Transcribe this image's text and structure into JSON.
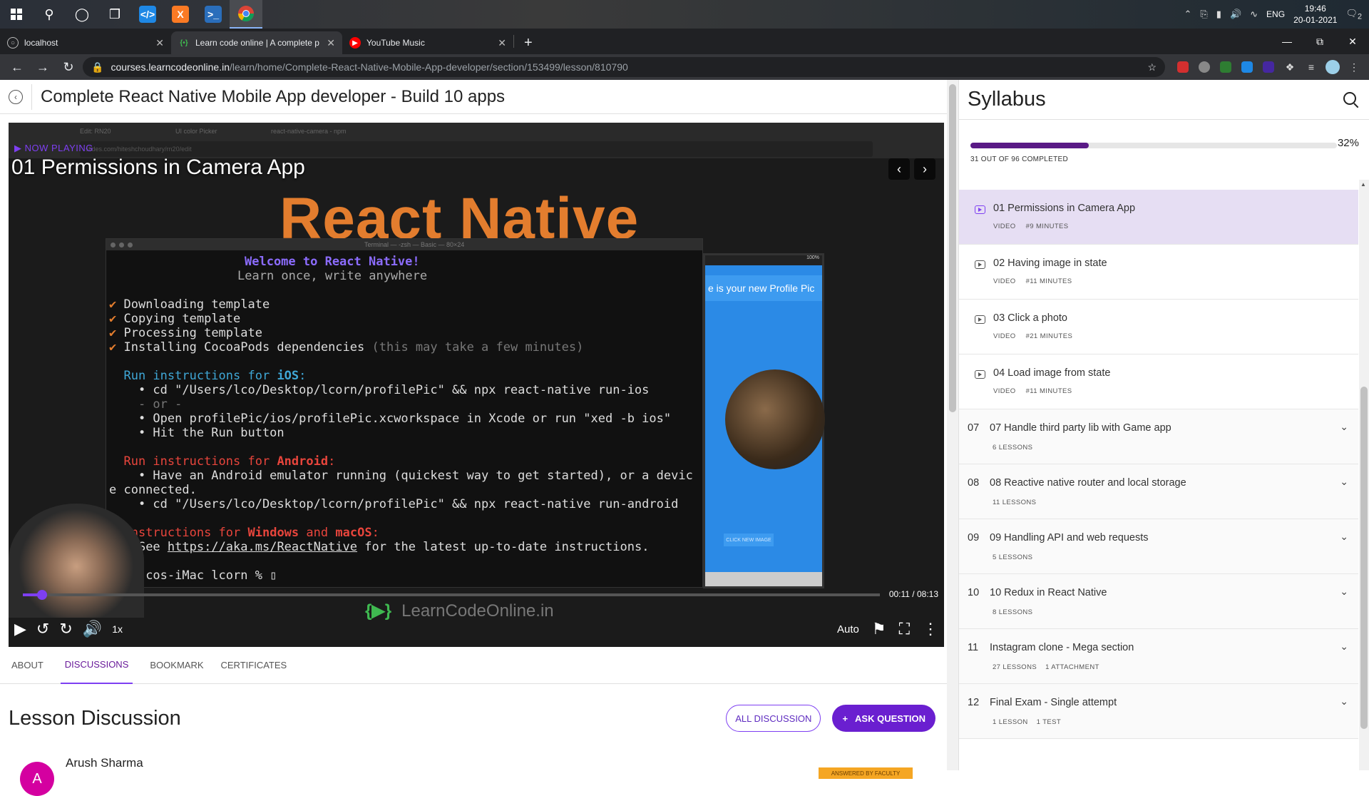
{
  "taskbar": {
    "time": "19:46",
    "date": "20-01-2021",
    "lang": "ENG",
    "notifications": "2"
  },
  "tabs": [
    {
      "title": "localhost",
      "icon": "globe-icon",
      "active": false
    },
    {
      "title": "Learn code online | A complete p",
      "icon": "lco-icon",
      "active": true
    },
    {
      "title": "YouTube Music",
      "icon": "youtube-music-icon",
      "active": false
    }
  ],
  "omnibox": {
    "host": "courses.learncodeonline.in",
    "path": "/learn/home/Complete-React-Native-Mobile-App-developer/section/153499/lesson/810790"
  },
  "header": {
    "course_title": "Complete React Native Mobile App developer - Build 10 apps"
  },
  "player": {
    "now_playing": "NOW PLAYING",
    "lesson_title": "01 Permissions in Camera App",
    "time": "00:11 / 08:13",
    "speed": "1x",
    "quality": "Auto",
    "progress": 0.0223
  },
  "video_frame": {
    "tab_labels": [
      "Edit: RN20",
      "UI color Picker",
      "react-native-camera - npm"
    ],
    "url": "slides.com/hiteshchoudhary/rn20/edit",
    "heading": "React Native",
    "terminal_title": "Terminal — -zsh — Basic — 80×24",
    "welcome": "Welcome to React Native!",
    "tagline": "Learn once, write anywhere",
    "steps": [
      "Downloading template",
      "Copying template",
      "Processing template",
      "Installing CocoaPods dependencies"
    ],
    "step_note": "(this may take a few minutes)",
    "ios_head_a": "Run instructions for",
    "ios_head_b": "iOS",
    "ios_cmd1": "cd \"/Users/lco/Desktop/lcorn/profilePic\" && npx react-native run-ios",
    "ios_or": "- or -",
    "ios_cmd2": "Open profilePic/ios/profilePic.xcworkspace in Xcode or run \"xed -b ios\"",
    "ios_cmd3": "Hit the Run button",
    "and_head_a": "Run instructions for",
    "and_head_b": "Android",
    "and_cmd1": "Have an Android emulator running (quickest way to get started), or a devic",
    "and_cmd1b": "e connected.",
    "and_cmd2": "cd \"/Users/lco/Desktop/lcorn/profilePic\" && npx react-native run-android",
    "win_head_a": "instructions for",
    "win_head_b": "Windows",
    "win_head_c": "and",
    "win_head_d": "macOS",
    "win_cmd_a": "See",
    "win_cmd_link": "https://aka.ms/ReactNative",
    "win_cmd_b": "for the latest up-to-date instructions.",
    "prompt": "cos-iMac lcorn % ",
    "phone_banner": "e is your new Profile Pic",
    "phone_button": "CLICK NEW IMAGE",
    "phone_status": "100%",
    "logo_text": "LearnCodeOnline.in"
  },
  "content_tabs": [
    "ABOUT",
    "DISCUSSIONS",
    "BOOKMARK",
    "CERTIFICATES"
  ],
  "discussion": {
    "title": "Lesson Discussion",
    "all_label": "ALL DISCUSSION",
    "ask_label": "ASK QUESTION",
    "author": "Arush Sharma",
    "avatar_letter": "A",
    "badge": "ANSWERED BY FACULTY"
  },
  "syllabus": {
    "title": "Syllabus",
    "percent_label": "32%",
    "completed_label": "31 OUT OF 96 COMPLETED",
    "completed": 31,
    "total": 96,
    "lessons": [
      {
        "title": "01 Permissions in Camera App",
        "type": "VIDEO",
        "duration": "#9 MINUTES",
        "current": true
      },
      {
        "title": "02 Having image in state",
        "type": "VIDEO",
        "duration": "#11 MINUTES",
        "current": false
      },
      {
        "title": "03 Click a photo",
        "type": "VIDEO",
        "duration": "#21 MINUTES",
        "current": false
      },
      {
        "title": "04 Load image from state",
        "type": "VIDEO",
        "duration": "#11 MINUTES",
        "current": false
      }
    ],
    "sections": [
      {
        "num": "07",
        "title": "07 Handle third party lib with Game app",
        "meta": [
          "6 LESSONS"
        ]
      },
      {
        "num": "08",
        "title": "08 Reactive native router and local storage",
        "meta": [
          "11 LESSONS"
        ]
      },
      {
        "num": "09",
        "title": "09 Handling API and web requests",
        "meta": [
          "5 LESSONS"
        ]
      },
      {
        "num": "10",
        "title": "10 Redux in React Native",
        "meta": [
          "8 LESSONS"
        ]
      },
      {
        "num": "11",
        "title": "Instagram clone - Mega section",
        "meta": [
          "27 LESSONS",
          "1 ATTACHMENT"
        ]
      },
      {
        "num": "12",
        "title": "Final Exam - Single attempt",
        "meta": [
          "1 LESSON",
          "1 TEST"
        ]
      }
    ]
  },
  "colors": {
    "accent": "#7e3ff2",
    "progress": "#5a1a86",
    "current_lesson_bg": "#e6def3",
    "react_native_orange": "#e37d2e"
  }
}
